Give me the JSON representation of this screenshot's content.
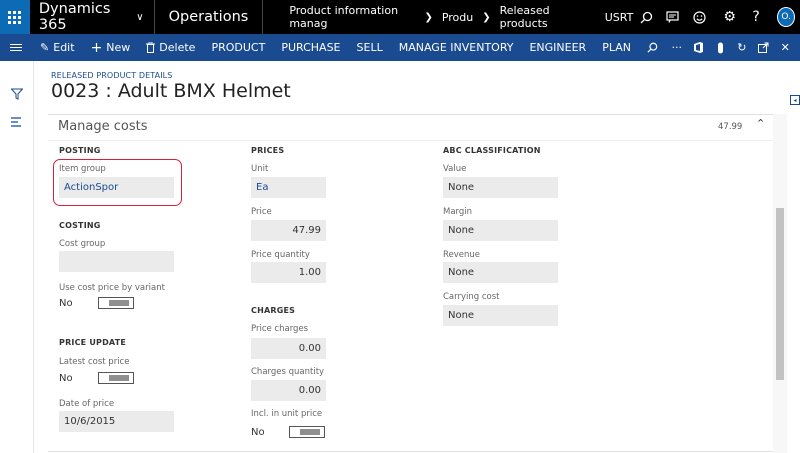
{
  "topbar": {
    "brand": "Dynamics 365",
    "module": "Operations",
    "breadcrumbs": [
      "Product information manag",
      "Produ",
      "Released products"
    ],
    "company": "USRT",
    "avatar_initials": "O."
  },
  "actionbar": {
    "edit": "Edit",
    "new": "New",
    "delete": "Delete",
    "menus": [
      "PRODUCT",
      "PURCHASE",
      "SELL",
      "MANAGE INVENTORY",
      "ENGINEER",
      "PLAN"
    ],
    "more": "···"
  },
  "header": {
    "caption": "RELEASED PRODUCT DETAILS",
    "title": "0023 : Adult BMX Helmet"
  },
  "fasttab": {
    "title": "Manage costs",
    "summary": "47.99"
  },
  "posting": {
    "header": "POSTING",
    "item_group_label": "Item group",
    "item_group_value": "ActionSpor"
  },
  "costing": {
    "header": "COSTING",
    "cost_group_label": "Cost group",
    "cost_group_value": "",
    "use_cost_price_label": "Use cost price by variant",
    "use_cost_price_value": "No"
  },
  "price_update": {
    "header": "PRICE UPDATE",
    "latest_cost_label": "Latest cost price",
    "latest_cost_value": "No",
    "date_label": "Date of price",
    "date_value": "10/6/2015"
  },
  "prices": {
    "header": "PRICES",
    "unit_label": "Unit",
    "unit_value": "Ea",
    "price_label": "Price",
    "price_value": "47.99",
    "qty_label": "Price quantity",
    "qty_value": "1.00"
  },
  "charges": {
    "header": "CHARGES",
    "price_charges_label": "Price charges",
    "price_charges_value": "0.00",
    "charges_qty_label": "Charges quantity",
    "charges_qty_value": "0.00",
    "incl_label": "Incl. in unit price",
    "incl_value": "No"
  },
  "abc": {
    "header": "ABC CLASSIFICATION",
    "value_label": "Value",
    "value_value": "None",
    "margin_label": "Margin",
    "margin_value": "None",
    "revenue_label": "Revenue",
    "revenue_value": "None",
    "carrying_label": "Carrying cost",
    "carrying_value": "None"
  },
  "colors": {
    "nav_bg": "#000000",
    "action_bg": "#1a4a8f",
    "waffle_bg": "#0d6ab5",
    "highlight": "#d1233b"
  },
  "icons": [
    "app-launcher-icon",
    "search-icon",
    "message-icon",
    "smiley-icon",
    "gear-icon",
    "help-icon",
    "hamburger-icon",
    "filter-icon",
    "list-icon",
    "edit-icon",
    "plus-icon",
    "delete-icon",
    "office-icon",
    "attach-icon",
    "refresh-icon",
    "popout-icon",
    "close-icon",
    "chevron-up-icon"
  ]
}
